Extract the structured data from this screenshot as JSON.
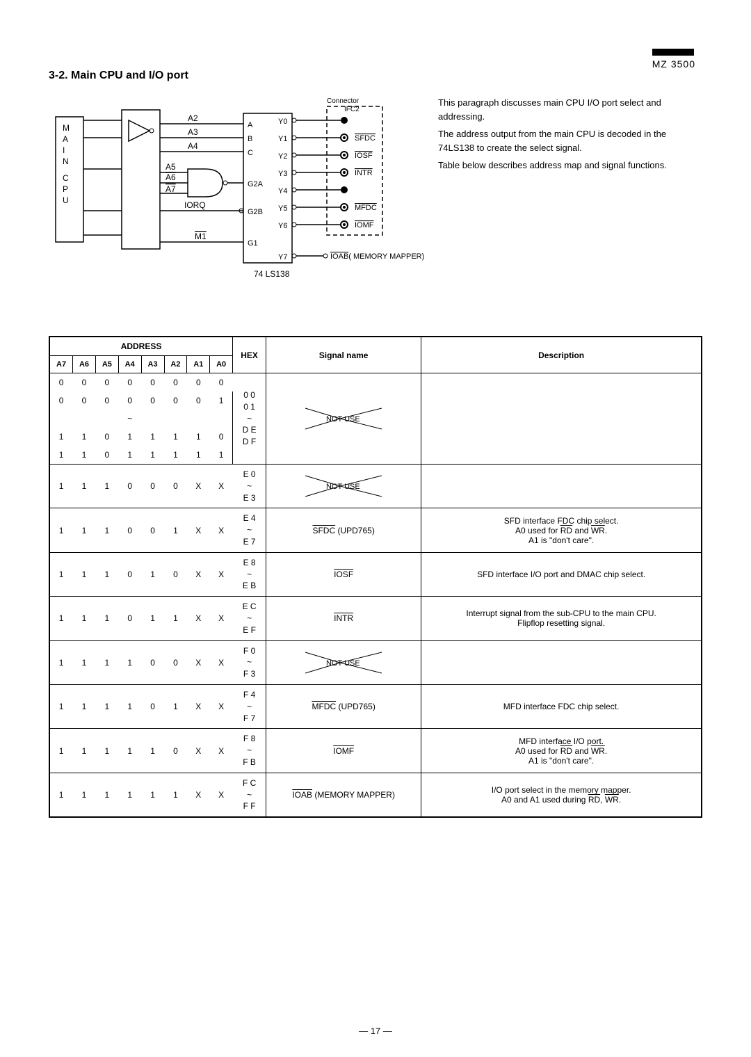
{
  "brand": "MZ 3500",
  "section_title": "3-2. Main CPU and I/O port",
  "paragraph": {
    "p1": "This paragraph discusses main CPU I/O port select and addressing.",
    "p2": "The address output from the main CPU is decoded in the 74LS138 to create the select signal.",
    "p3": "Table below describes address map and signal functions."
  },
  "diagram": {
    "main_cpu": "M\nA\nI\nN\n\nC\nP\nU",
    "a2": "A2",
    "a3": "A3",
    "a4": "A4",
    "a5": "A5",
    "a6": "A6",
    "a7": "A7",
    "iorq": "IORQ",
    "m1": "M1",
    "decoder_a": "A",
    "decoder_b": "B",
    "decoder_c": "C",
    "decoder_g2a": "G2A",
    "decoder_g2b": "G2B",
    "decoder_g1": "G1",
    "y0": "Y0",
    "y1": "Y1",
    "y2": "Y2",
    "y3": "Y3",
    "y4": "Y4",
    "y5": "Y5",
    "y6": "Y6",
    "y7": "Y7",
    "connector": "Connector",
    "ifc2": "IFC2",
    "sfdc": "SFDC",
    "iosf": "IOSF",
    "intr": "INTR",
    "mfdc": "MFDC",
    "iomf": "IOMF",
    "ioab_mapper": "IOAB( MEMORY MAPPER)",
    "ic_label": "74 LS138"
  },
  "table": {
    "header_address": "ADDRESS",
    "header_hex": "HEX",
    "header_signal": "Signal name",
    "header_desc": "Description",
    "cols": [
      "A7",
      "A6",
      "A5",
      "A4",
      "A3",
      "A2",
      "A1",
      "A0"
    ],
    "rows": [
      {
        "addr_rows": [
          [
            "0",
            "0",
            "0",
            "0",
            "0",
            "0",
            "0",
            "0"
          ],
          [
            "0",
            "0",
            "0",
            "0",
            "0",
            "0",
            "0",
            "1"
          ],
          [
            "",
            "",
            "",
            "~",
            "",
            "",
            "",
            ""
          ],
          [
            "1",
            "1",
            "0",
            "1",
            "1",
            "1",
            "1",
            "0"
          ],
          [
            "1",
            "1",
            "0",
            "1",
            "1",
            "1",
            "1",
            "1"
          ]
        ],
        "hex": "0 0\n0 1\n~\nD E\nD F",
        "signal": "NOT USE",
        "signal_type": "notuse",
        "desc": ""
      },
      {
        "addr_rows": [
          [
            "1",
            "1",
            "1",
            "0",
            "0",
            "0",
            "X",
            "X"
          ]
        ],
        "hex": "E 0\n~\nE 3",
        "signal": "NOT USE",
        "signal_type": "notuse",
        "desc": ""
      },
      {
        "addr_rows": [
          [
            "1",
            "1",
            "1",
            "0",
            "0",
            "1",
            "X",
            "X"
          ]
        ],
        "hex": "E 4\n~\nE 7",
        "signal": "SFDC (UPD765)",
        "signal_overline": "SFDC",
        "desc": "SFD interface FDC chip select.\nA0 used for RD and WR.\nA1 is \"don't care\"."
      },
      {
        "addr_rows": [
          [
            "1",
            "1",
            "1",
            "0",
            "1",
            "0",
            "X",
            "X"
          ]
        ],
        "hex": "E 8\n~\nE B",
        "signal": "IOSF",
        "signal_overline": "IOSF",
        "desc": "SFD interface I/O port and DMAC chip select."
      },
      {
        "addr_rows": [
          [
            "1",
            "1",
            "1",
            "0",
            "1",
            "1",
            "X",
            "X"
          ]
        ],
        "hex": "E C\n~\nE F",
        "signal": "INTR",
        "signal_overline": "INTR",
        "desc": "Interrupt signal from the sub-CPU to the main CPU.\nFlipflop resetting signal."
      },
      {
        "addr_rows": [
          [
            "1",
            "1",
            "1",
            "1",
            "0",
            "0",
            "X",
            "X"
          ]
        ],
        "hex": "F 0\n~\nF 3",
        "signal": "NOT USE",
        "signal_type": "notuse",
        "desc": ""
      },
      {
        "addr_rows": [
          [
            "1",
            "1",
            "1",
            "1",
            "0",
            "1",
            "X",
            "X"
          ]
        ],
        "hex": "F 4\n~\nF 7",
        "signal": "MFDC (UPD765)",
        "signal_overline": "MFDC",
        "desc": "MFD interface FDC chip select."
      },
      {
        "addr_rows": [
          [
            "1",
            "1",
            "1",
            "1",
            "1",
            "0",
            "X",
            "X"
          ]
        ],
        "hex": "F 8\n~\nF B",
        "signal": "IOMF",
        "signal_overline": "IOMF",
        "desc": "MFD interface I/O port.\nA0 used for RD and WR.\nA1 is \"don't care\"."
      },
      {
        "addr_rows": [
          [
            "1",
            "1",
            "1",
            "1",
            "1",
            "1",
            "X",
            "X"
          ]
        ],
        "hex": "F C\n~\nF F",
        "signal": "IOAB (MEMORY MAPPER)",
        "signal_overline": "IOAB",
        "desc": "I/O port select in the memory mapper.\nA0 and A1 used during RD, WR."
      }
    ]
  },
  "page_number": "— 17 —"
}
